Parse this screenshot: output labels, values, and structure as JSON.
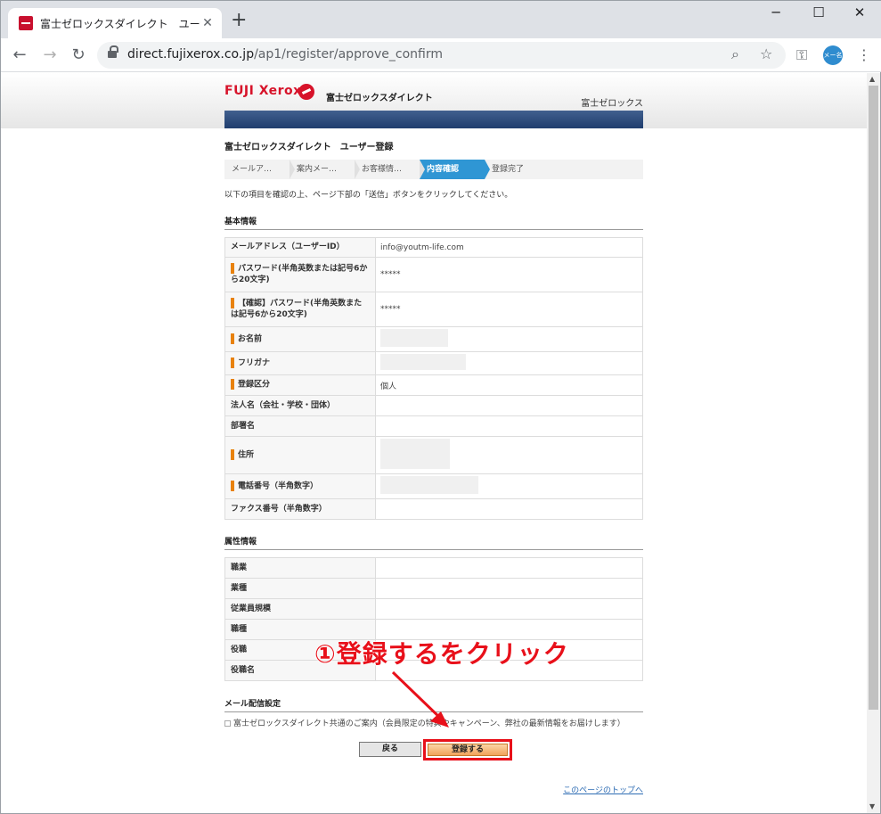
{
  "browser": {
    "tab_title": "富士ゼロックスダイレクト　ユーザー登録",
    "tab_close": "✕",
    "new_tab": "+",
    "minimize": "─",
    "maximize": "☐",
    "close": "✕",
    "url_host": "direct.fujixerox.co.jp",
    "url_path": "/ap1/register/approve_confirm",
    "avatar_text": "メー名"
  },
  "header": {
    "logo": "FUJI Xerox",
    "site_name": "富士ゼロックスダイレクト",
    "corp_name": "富士ゼロックス"
  },
  "page": {
    "title": "富士ゼロックスダイレクト　ユーザー登録",
    "steps": [
      "メールア…",
      "案内メー…",
      "お客様情…",
      "内容確認",
      "登録完了"
    ],
    "active_step": 3,
    "instruction": "以下の項目を確認の上、ページ下部の「送信」ボタンをクリックしてください。"
  },
  "basic": {
    "section_title": "基本情報",
    "rows": [
      {
        "label": "メールアドレス（ユーザーID）",
        "value": "info@youtm-life.com",
        "required": false
      },
      {
        "label": "パスワード(半角英数または記号6から20文字)",
        "value": "*****",
        "required": true
      },
      {
        "label": "【確認】パスワード(半角英数または記号6から20文字)",
        "value": "*****",
        "required": true
      },
      {
        "label": "お名前",
        "value": "",
        "required": true
      },
      {
        "label": "フリガナ",
        "value": "",
        "required": true
      },
      {
        "label": "登録区分",
        "value": "個人",
        "required": true
      },
      {
        "label": "法人名（会社・学校・団体）",
        "value": "",
        "required": false
      },
      {
        "label": "部署名",
        "value": "",
        "required": false
      },
      {
        "label": "住所",
        "value": "",
        "required": true
      },
      {
        "label": "電話番号（半角数字）",
        "value": "",
        "required": true
      },
      {
        "label": "ファクス番号（半角数字）",
        "value": "",
        "required": false
      }
    ]
  },
  "attributes": {
    "section_title": "属性情報",
    "rows": [
      {
        "label": "職業",
        "value": ""
      },
      {
        "label": "業種",
        "value": ""
      },
      {
        "label": "従業員規模",
        "value": ""
      },
      {
        "label": "職種",
        "value": ""
      },
      {
        "label": "役職",
        "value": ""
      },
      {
        "label": "役職名",
        "value": ""
      }
    ]
  },
  "mail": {
    "section_title": "メール配信設定",
    "text": "富士ゼロックスダイレクト共通のご案内（会員限定の特典やキャンペーン、弊社の最新情報をお届けします）"
  },
  "buttons": {
    "back": "戻る",
    "submit": "登録する"
  },
  "footer": {
    "top_link": "このページのトップへ"
  },
  "annotation": {
    "text": "①登録するをクリック",
    "color": "#e8101a"
  }
}
